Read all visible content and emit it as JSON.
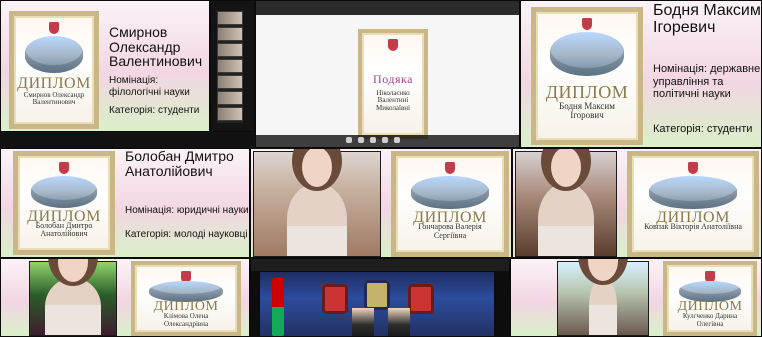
{
  "tiles": {
    "t1": {
      "diploma": "Диплом",
      "name_small": "Смирнов Олександр Валентинович",
      "big_name": "Смирнов Олександр Валентинович",
      "nomination": "Номінація: філологічні науки",
      "category": "Категорія: студенти"
    },
    "t2": {
      "podyaka": "Подяка",
      "name": "Ніколаєнко Валентині Миколаївні"
    },
    "t3": {
      "diploma": "Диплом",
      "name_small": "Бодня Максим Ігорович",
      "big_name": "Бодня Максим Ігоревич",
      "nomination": "Номінація: державне управління та політичні науки",
      "category": "Категорія: студенти"
    },
    "t4": {
      "diploma": "Диплом",
      "name_small": "Болобан Дмитро Анатолійович",
      "big_name": "Болобан Дмитро Анатолійович",
      "nomination": "Номінація: юридичні науки",
      "category": "Категорія: молоді науковці"
    },
    "t5": {
      "diploma": "Диплом",
      "name_small": "Гончарова Валерія Сергіївна"
    },
    "t6": {
      "diploma": "Диплом",
      "name_small": "Ковпак Вікторія Анатоліївна"
    },
    "t7": {
      "diploma": "Диплом",
      "name_small": "Клімова Олена Олександрівна"
    },
    "t8": {
      "diploma": "Диплом",
      "name_small": "Кулгченко Дарина Олегівна"
    }
  }
}
